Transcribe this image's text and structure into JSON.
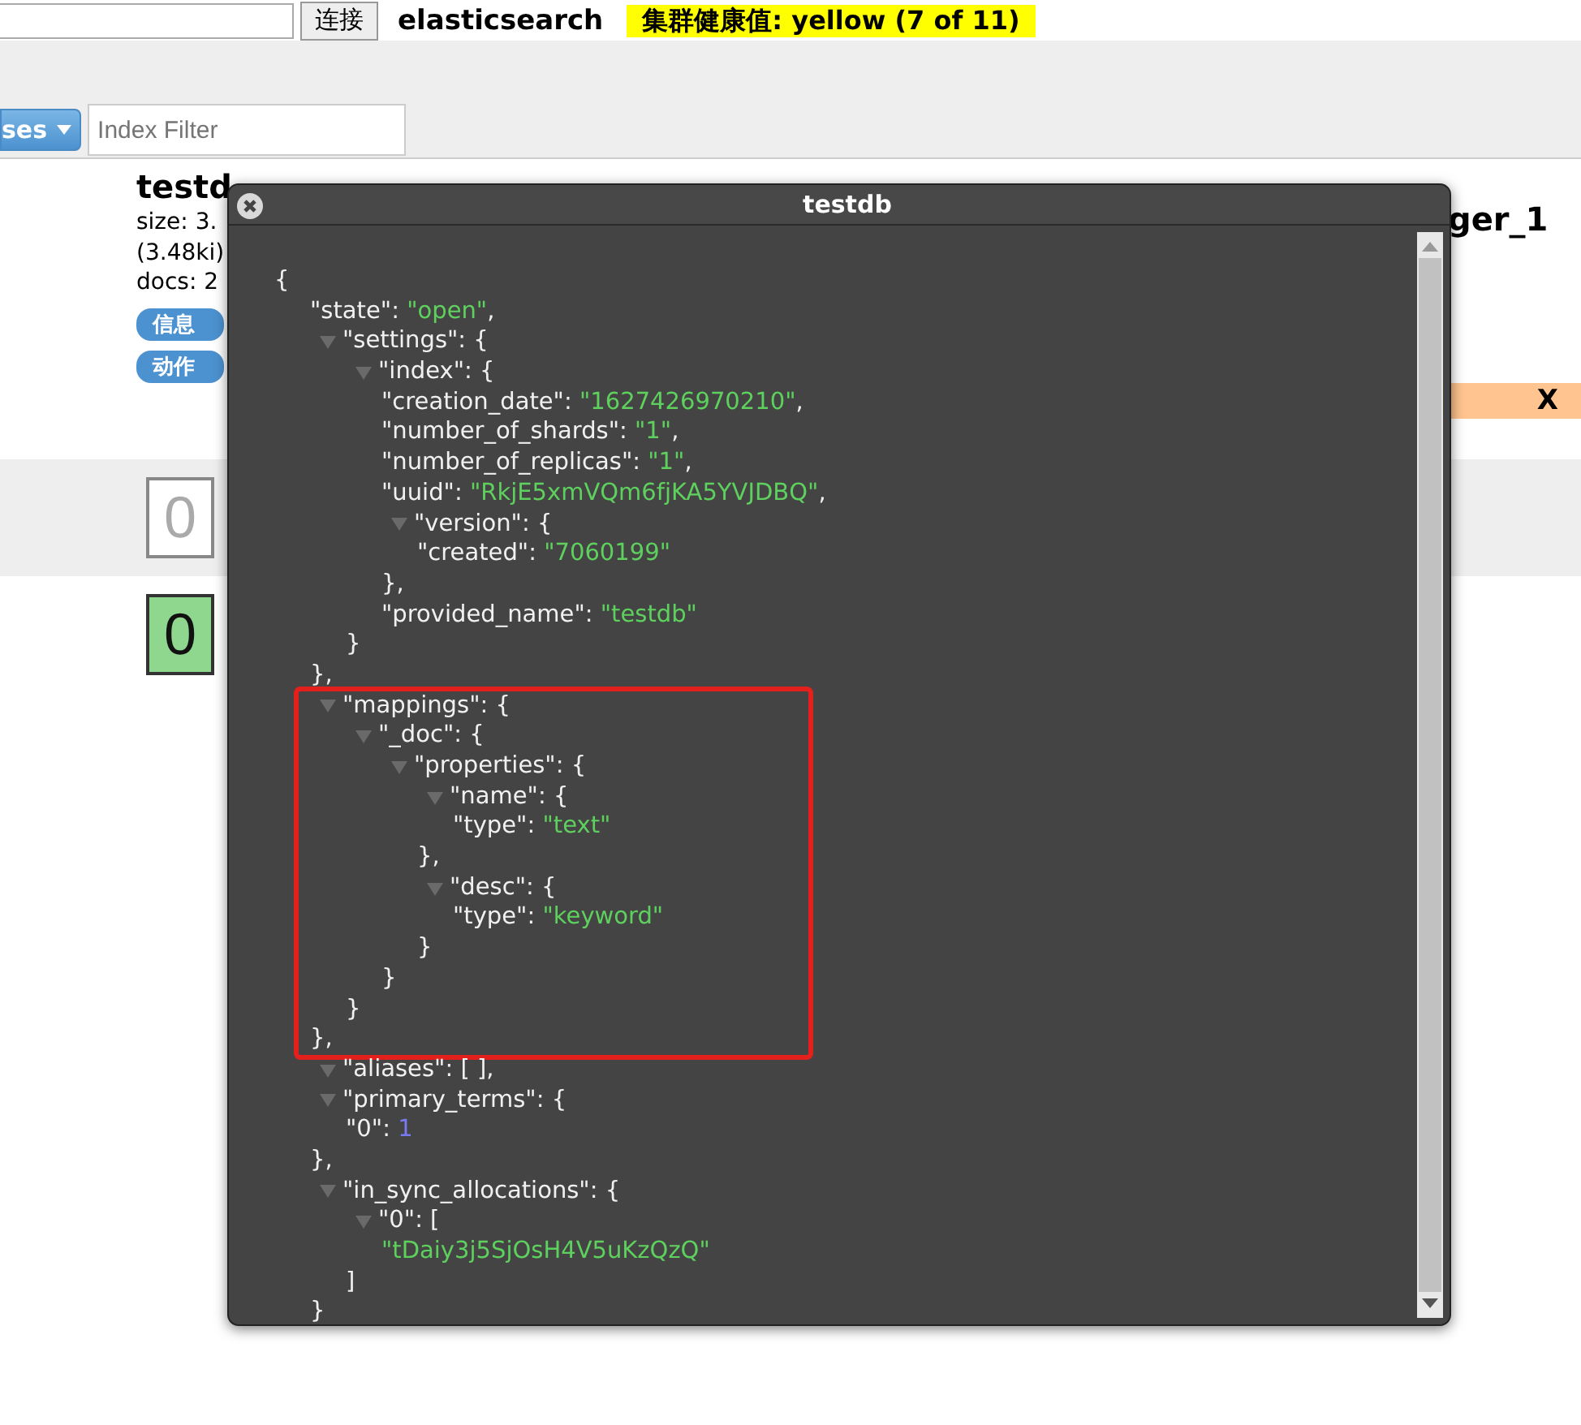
{
  "header": {
    "connect_button": "连接",
    "cluster_name": "elasticsearch",
    "health": "集群健康值: yellow (7 of 11)"
  },
  "toolbar": {
    "menu_button": "ses",
    "filter": {
      "placeholder": "Index Filter"
    }
  },
  "left_index": {
    "name": "testd",
    "size": "size: 3.",
    "size_detail": "(3.48ki)",
    "docs": "docs: 2",
    "buttons": [
      "信息",
      "动作"
    ],
    "shards": [
      {
        "label": "0",
        "kind": "unassigned"
      },
      {
        "label": "0",
        "kind": "primary"
      }
    ]
  },
  "right_index": {
    "name": "ger_1",
    "alias_close": "X"
  },
  "dialog": {
    "title": "testdb",
    "json": {
      "open": "{",
      "children": [
        {
          "kind": "string",
          "key_text": "\"state\": ",
          "value": "\"open\"",
          "suffix": ","
        },
        {
          "kind": "object",
          "key_text": "\"settings\": {",
          "expanded": true,
          "close": "},",
          "children": [
            {
              "kind": "object",
              "key_text": "\"index\": {",
              "expanded": true,
              "close": "}",
              "children": [
                {
                  "kind": "string",
                  "key_text": "\"creation_date\": ",
                  "value": "\"1627426970210\"",
                  "suffix": ","
                },
                {
                  "kind": "string",
                  "key_text": "\"number_of_shards\": ",
                  "value": "\"1\"",
                  "suffix": ","
                },
                {
                  "kind": "string",
                  "key_text": "\"number_of_replicas\": ",
                  "value": "\"1\"",
                  "suffix": ","
                },
                {
                  "kind": "string",
                  "key_text": "\"uuid\": ",
                  "value": "\"RkjE5xmVQm6fjKA5YVJDBQ\"",
                  "suffix": ","
                },
                {
                  "kind": "object",
                  "key_text": "\"version\": {",
                  "expanded": true,
                  "close": "},",
                  "children": [
                    {
                      "kind": "string",
                      "key_text": "\"created\": ",
                      "value": "\"7060199\""
                    }
                  ]
                },
                {
                  "kind": "string",
                  "key_text": "\"provided_name\": ",
                  "value": "\"testdb\""
                }
              ]
            }
          ]
        },
        {
          "kind": "object",
          "key_text": "\"mappings\": {",
          "expanded": true,
          "highlighted": true,
          "close": "},",
          "children": [
            {
              "kind": "object",
              "key_text": "\"_doc\": {",
              "expanded": true,
              "close": "}",
              "children": [
                {
                  "kind": "object",
                  "key_text": "\"properties\": {",
                  "expanded": true,
                  "close": "}",
                  "children": [
                    {
                      "kind": "object",
                      "key_text": "\"name\": {",
                      "expanded": true,
                      "close": "},",
                      "children": [
                        {
                          "kind": "string",
                          "key_text": "\"type\": ",
                          "value": "\"text\""
                        }
                      ]
                    },
                    {
                      "kind": "object",
                      "key_text": "\"desc\": {",
                      "expanded": true,
                      "close": "}",
                      "children": [
                        {
                          "kind": "string",
                          "key_text": "\"type\": ",
                          "value": "\"keyword\""
                        }
                      ]
                    }
                  ]
                }
              ]
            }
          ]
        },
        {
          "kind": "object",
          "key_text": "\"aliases\": [ ],",
          "expanded": true
        },
        {
          "kind": "object",
          "key_text": "\"primary_terms\": {",
          "expanded": true,
          "close": "},",
          "children": [
            {
              "kind": "number",
              "key_text": "\"0\": ",
              "value": "1"
            }
          ]
        },
        {
          "kind": "object",
          "key_text": "\"in_sync_allocations\": {",
          "expanded": true,
          "close": "}",
          "children": [
            {
              "kind": "object",
              "key_text": "\"0\": [",
              "expanded": true,
              "close": "]",
              "children": [
                {
                  "kind": "string",
                  "value": "\"tDaiy3j5SjOsH4V5uKzQzQ\""
                }
              ]
            }
          ]
        }
      ]
    }
  }
}
